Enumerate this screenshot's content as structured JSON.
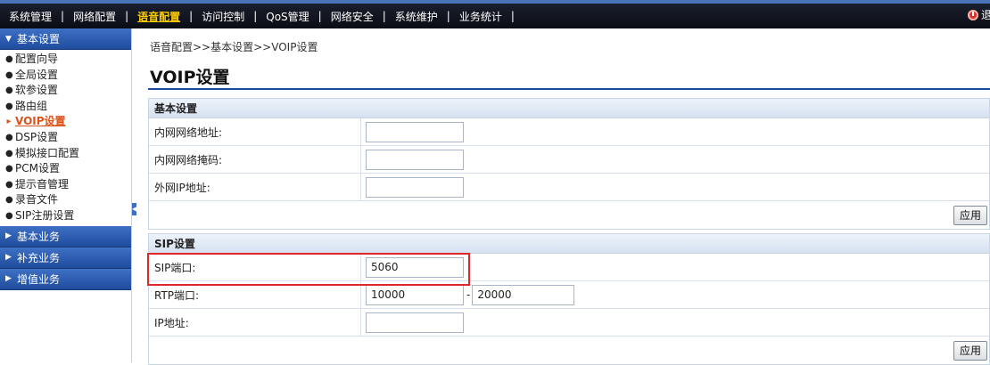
{
  "topnav": {
    "items": [
      "系统管理",
      "网络配置",
      "语音配置",
      "访问控制",
      "QoS管理",
      "网络安全",
      "系统维护",
      "业务统计"
    ],
    "active_index": 2,
    "right_label": "退"
  },
  "sidebar": {
    "groups": [
      {
        "label": "基本设置",
        "expanded": true,
        "items": [
          "配置向导",
          "全局设置",
          "软参设置",
          "路由组",
          "VOIP设置",
          "DSP设置",
          "模拟接口配置",
          "PCM设置",
          "提示音管理",
          "录音文件",
          "SIP注册设置"
        ],
        "active_index": 4
      },
      {
        "label": "基本业务",
        "expanded": false
      },
      {
        "label": "补充业务",
        "expanded": false
      },
      {
        "label": "增值业务",
        "expanded": false
      }
    ]
  },
  "breadcrumb": "语音配置>>基本设置>>VOIP设置",
  "page_title": "VOIP设置",
  "basic_section": {
    "title": "基本设置",
    "fields": [
      {
        "label": "内网网络地址:",
        "value": ""
      },
      {
        "label": "内网网络掩码:",
        "value": ""
      },
      {
        "label": "外网IP地址:",
        "value": ""
      }
    ],
    "apply_label": "应用"
  },
  "sip_section": {
    "title": "SIP设置",
    "sip_port": {
      "label": "SIP端口:",
      "value": "5060"
    },
    "rtp_port": {
      "label": "RTP端口:",
      "from": "10000",
      "separator": "-",
      "to": "20000"
    },
    "ip_address": {
      "label": "IP地址:",
      "value": ""
    },
    "apply_label": "应用"
  },
  "colors": {
    "accent": "#1f4d9e",
    "active_link": "#d9531b",
    "highlight": "#e02828"
  }
}
